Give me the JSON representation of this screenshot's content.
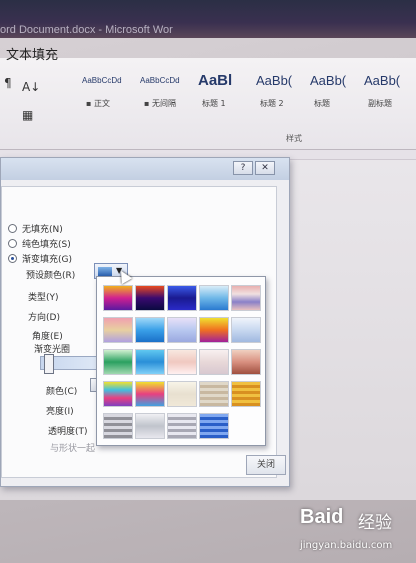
{
  "window": {
    "title": "ord Document.docx - Microsoft Wor"
  },
  "ribbon": {
    "tools": [
      {
        "glyph": "¶",
        "label": ""
      },
      {
        "glyph": "A↓",
        "label": ""
      },
      {
        "glyph": "▦",
        "label": ""
      }
    ],
    "styles": [
      {
        "preview": "AaBbCcDd",
        "name": "▪ 正文",
        "size": "8px"
      },
      {
        "preview": "AaBbCcDd",
        "name": "▪ 无间隔",
        "size": "8px"
      },
      {
        "preview": "AaBl",
        "name": "标题 1",
        "size": "15px"
      },
      {
        "preview": "AaBb(",
        "name": "标题 2",
        "size": "13px"
      },
      {
        "preview": "AaBb(",
        "name": "标题",
        "size": "13px"
      },
      {
        "preview": "AaBb(",
        "name": "副标题",
        "size": "13px"
      }
    ],
    "group_label": "样式"
  },
  "dialog": {
    "section_title": "文本填充",
    "fill_options": [
      {
        "label": "无填充(N)",
        "selected": false
      },
      {
        "label": "纯色填充(S)",
        "selected": false
      },
      {
        "label": "渐变填充(G)",
        "selected": true
      }
    ],
    "preset_label": "预设颜色(R)",
    "type_label": "类型(Y)",
    "direction_label": "方向(D)",
    "angle_label": "角度(E)",
    "gradient_stops_label": "渐变光圈",
    "color_label": "颜色(C)",
    "brightness_label": "亮度(I)",
    "transparency_label": "透明度(T)",
    "rotate_label": "与形状一起",
    "close_label": "关闭"
  },
  "gradient_presets": [
    [
      "#f0b020",
      "#5a1aa0",
      "#2a2aa8",
      "#6fb8e8",
      "#e8b0b0"
    ],
    [
      "#f0a0b0",
      "#3aa0e8",
      "#b8c8f0",
      "#f0c020",
      "#c8d8f0"
    ],
    [
      "#2aa060",
      "#2a8fd8",
      "#f0c8c0",
      "#e8d8d8",
      "#d89080"
    ],
    [
      "#f0e030",
      "#e84080",
      "#e8e0d0",
      "#e0d8c8",
      "#d8a020"
    ],
    [
      "#909098",
      "#c0c4cc",
      "#a8a8b4",
      "#2a5fc8",
      "#ffffff"
    ]
  ],
  "watermark": {
    "brand": "Baid",
    "jing": "经验",
    "url": "jingyan.baidu.com"
  }
}
